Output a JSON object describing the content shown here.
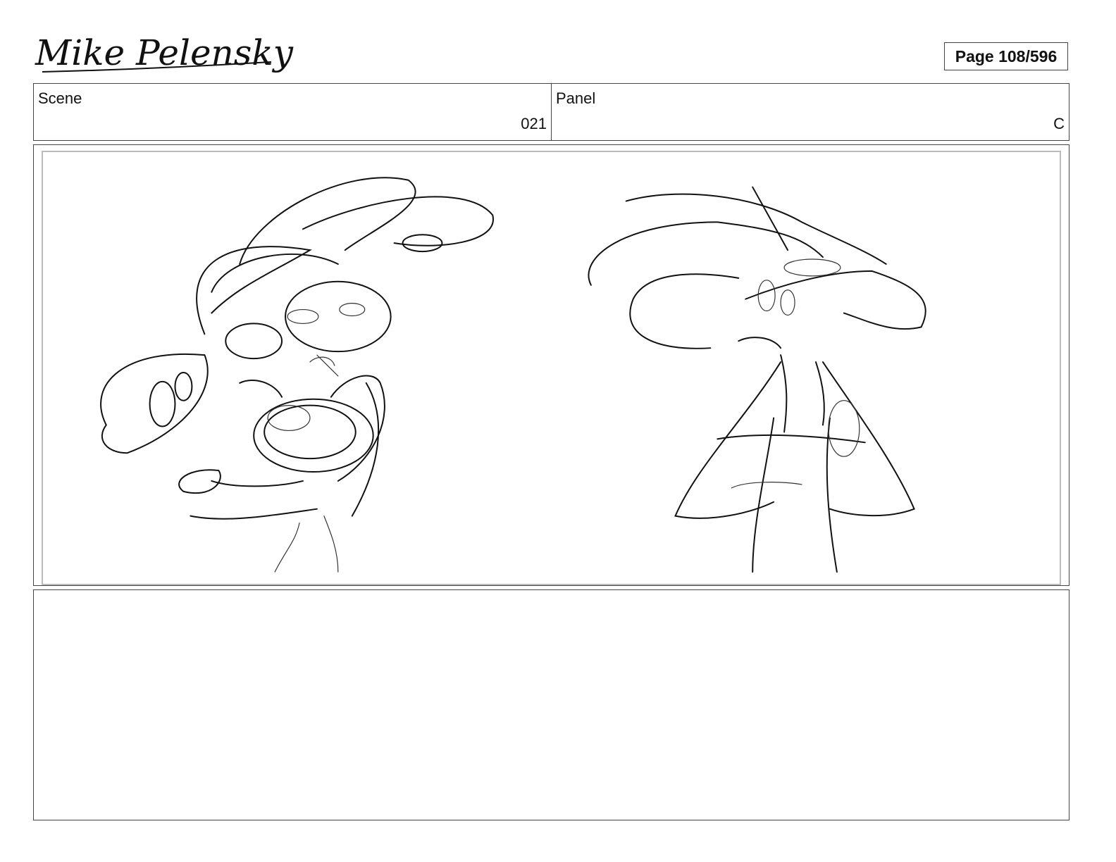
{
  "header": {
    "signature_text": "Mike Pelensky",
    "page_label": "Page 108/596"
  },
  "info": {
    "scene_label": "Scene",
    "scene_value": "021",
    "panel_label": "Panel",
    "panel_value": "C"
  },
  "notes": {
    "text": ""
  }
}
